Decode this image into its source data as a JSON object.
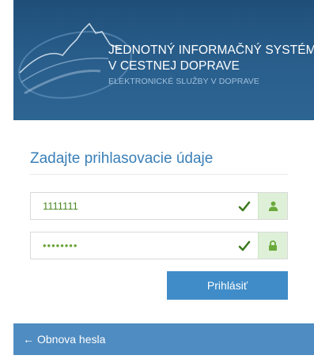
{
  "header": {
    "title_line1": "JEDNOTNÝ INFORMAČNÝ SYSTÉM",
    "title_line2": "V CESTNEJ DOPRAVE",
    "subtitle": "ELEKTRONICKÉ SLUŽBY V DOPRAVE"
  },
  "login": {
    "heading": "Zadajte prihlasovacie údaje",
    "username_value": "1111111",
    "password_masked": "••••••••",
    "submit_label": "Prihlásiť"
  },
  "footer": {
    "arrow_glyph": "←",
    "link_label": "Obnova hesla"
  },
  "icons": [
    "mountain-logo-icon",
    "check-icon",
    "user-icon",
    "lock-icon",
    "arrow-left-icon"
  ],
  "colors": {
    "banner": "#2a5f8d",
    "heading": "#3a7fb7",
    "valid": "#4e8a27",
    "addon": "#dff0d8",
    "button": "#3f8cc8",
    "footer": "#4f8cc1"
  }
}
